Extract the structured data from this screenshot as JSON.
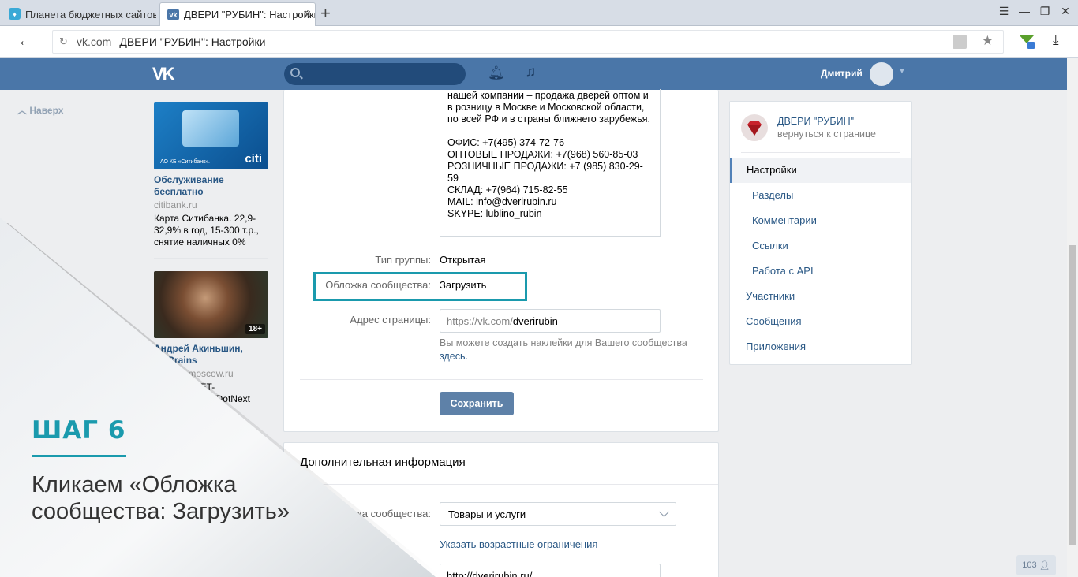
{
  "browser": {
    "tab1_title": "Планета бюджетных сайтов",
    "tab2_title": "ДВЕРИ \"РУБИН\": Настройки",
    "new_tab": "+",
    "url_domain": "vk.com",
    "url_title": "ДВЕРИ \"РУБИН\": Настройки"
  },
  "header": {
    "logo": "VK",
    "user_name": "Дмитрий"
  },
  "left": {
    "back_to_top": "Наверх",
    "ad1": {
      "image_text": "АО КБ «Ситибанк».",
      "title": "Обслуживание бесплатно",
      "domain": "citibank.ru",
      "text": "Карта Ситибанка. 22,9-32,9% в год, 15-300 т.р., снятие наличных 0%"
    },
    "ad2": {
      "badge": "18+",
      "title": "Андрей Акиньшин, JetBrains",
      "domain": "dotnext-moscow.ru",
      "text": "Лекция, .NET-конференция DotNext 2016 Москва и"
    }
  },
  "main": {
    "description_lines": [
      "нашей компании – продажа дверей оптом и в розницу в Москве и Московской области, по всей РФ и в страны ближнего зарубежья.",
      "ОФИС: +7(495) 374-72-76\nОПТОВЫЕ ПРОДАЖИ:  +7(968) 560-85-03\nРОЗНИЧНЫЕ ПРОДАЖИ:  +7 (985) 830-29-59\nСКЛАД: +7(964) 715-82-55\nMAIL: info@dverirubin.ru\nSKYPE: lublino_rubin"
    ],
    "group_type_label": "Тип группы:",
    "group_type_value": "Открытая",
    "cover_label": "Обложка сообщества:",
    "cover_value": "Загрузить",
    "address_label": "Адрес страницы:",
    "address_prefix": "https://vk.com/",
    "address_value": "dverirubin",
    "hint_text": "Вы можете создать наклейки для Вашего сообщества",
    "hint_link": "здесь.",
    "save_button": "Сохранить",
    "extra_title": "Дополнительная информация",
    "category_label": "Тематика сообщества:",
    "category_value": "Товары и услуги",
    "age_link": "Указать возрастные ограничения",
    "site_value": "http://dverirubin.ru/"
  },
  "right": {
    "group_name": "ДВЕРИ \"РУБИН\"",
    "back_link": "вернуться к странице",
    "menu": [
      {
        "label": "Настройки"
      },
      {
        "label": "Разделы"
      },
      {
        "label": "Комментарии"
      },
      {
        "label": "Ссылки"
      },
      {
        "label": "Работа с API"
      },
      {
        "label": "Участники"
      },
      {
        "label": "Сообщения"
      },
      {
        "label": "Приложения"
      }
    ]
  },
  "overlay": {
    "step": "ШАГ 6",
    "text": "Кликаем «Обложка сообщества: Загрузить»"
  },
  "footer": {
    "counter": "103"
  },
  "colors": {
    "vk_blue": "#4a76a8",
    "accent_teal": "#1a9aad",
    "link": "#2a5885"
  }
}
